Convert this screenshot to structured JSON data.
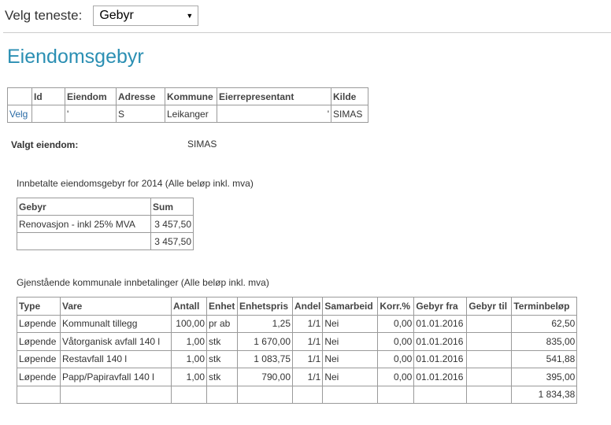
{
  "top": {
    "service_label": "Velg teneste:",
    "service_selected": "Gebyr"
  },
  "page_title": "Eiendomsgebyr",
  "property_table": {
    "headers": [
      "",
      "Id",
      "Eiendom",
      "Adresse",
      "Kommune",
      "Eierrepresentant",
      "Kilde"
    ],
    "row": {
      "select": "Velg",
      "id": "",
      "eiendom": "'",
      "adresse": "S",
      "kommune": "Leikanger",
      "eier": "'",
      "kilde": "SIMAS"
    }
  },
  "selected_property": {
    "label": "Valgt eiendom:",
    "value": "SIMAS"
  },
  "paid": {
    "caption": "Innbetalte eiendomsgebyr for 2014 (Alle beløp inkl. mva)",
    "headers": [
      "Gebyr",
      "Sum"
    ],
    "rows": [
      [
        "Renovasjon - inkl 25% MVA",
        "3 457,50"
      ]
    ],
    "total": "3 457,50"
  },
  "remaining": {
    "caption": "Gjenstående kommunale innbetalinger (Alle beløp inkl. mva)",
    "headers": [
      "Type",
      "Vare",
      "Antall",
      "Enhet",
      "Enhetspris",
      "Andel",
      "Samarbeid",
      "Korr.%",
      "Gebyr fra",
      "Gebyr til",
      "Terminbeløp"
    ],
    "rows": [
      [
        "Løpende",
        "Kommunalt tillegg",
        "100,00",
        "pr ab",
        "1,25",
        "1/1",
        "Nei",
        "0,00",
        "01.01.2016",
        "",
        "62,50"
      ],
      [
        "Løpende",
        "Våtorganisk avfall 140 l",
        "1,00",
        "stk",
        "1 670,00",
        "1/1",
        "Nei",
        "0,00",
        "01.01.2016",
        "",
        "835,00"
      ],
      [
        "Løpende",
        "Restavfall 140 l",
        "1,00",
        "stk",
        "1 083,75",
        "1/1",
        "Nei",
        "0,00",
        "01.01.2016",
        "",
        "541,88"
      ],
      [
        "Løpende",
        "Papp/Papiravfall 140 l",
        "1,00",
        "stk",
        "790,00",
        "1/1",
        "Nei",
        "0,00",
        "01.01.2016",
        "",
        "395,00"
      ]
    ],
    "total": "1 834,38"
  }
}
